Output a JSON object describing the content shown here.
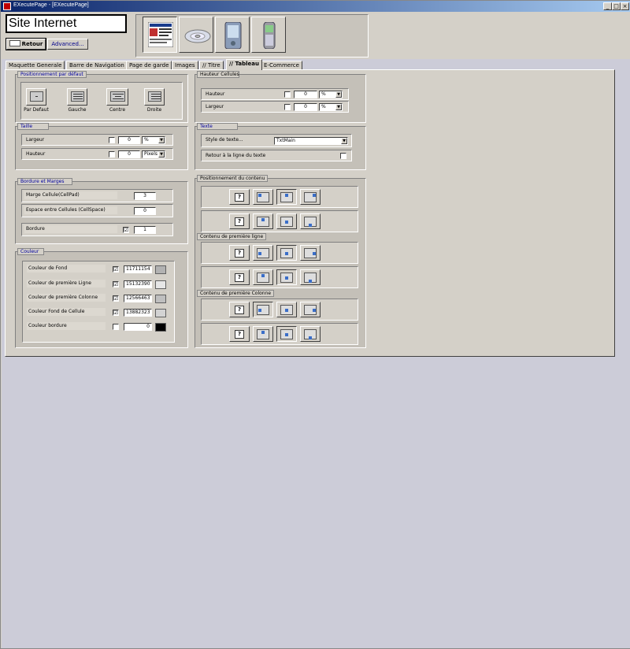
{
  "window": {
    "title": "EXecutePage - [EXecutePage]",
    "buttons": [
      "_",
      "□",
      "×"
    ]
  },
  "header": {
    "site_title": "Site Internet",
    "back_label": "Retour",
    "advanced_label": "Advanced..."
  },
  "tabs": [
    {
      "label": "Maquette Generale"
    },
    {
      "label": "Barre de Navigation"
    },
    {
      "label": "Page de garde"
    },
    {
      "label": "Images"
    },
    {
      "label": "// Titre"
    },
    {
      "label": "// Tableau"
    },
    {
      "label": "E-Commerce"
    }
  ],
  "positionnement_defaut": {
    "label": "Positionnement par défaut",
    "options": [
      "Par Defaut",
      "Gauche",
      "Centre",
      "Droite"
    ]
  },
  "taille": {
    "label": "Taille",
    "largeur": {
      "label": "Largeur",
      "value": "0",
      "unit": "%"
    },
    "hauteur": {
      "label": "Hauteur",
      "value": "0",
      "unit": "Pixels"
    }
  },
  "hauteur_cellules": {
    "label": "Hauteur Cellules",
    "hauteur": {
      "label": "Hauteur",
      "value": "0",
      "unit": "%"
    },
    "largeur": {
      "label": "Largeur",
      "value": "0",
      "unit": "%"
    }
  },
  "texte": {
    "label": "Texte",
    "style": {
      "label": "Style de texte...",
      "value": "TxtMain"
    },
    "retour": {
      "label": "Retour à la ligne du texte"
    }
  },
  "bordure": {
    "label": "Bordure et Marges",
    "marge": {
      "label": "Marge Cellule(CellPad)",
      "value": "3"
    },
    "espace": {
      "label": "Espace entre Cellules (CellSpace)",
      "value": "0"
    },
    "bordure": {
      "label": "Bordure",
      "value": "1",
      "check": "☑"
    }
  },
  "couleur": {
    "label": "Couleur",
    "rows": [
      {
        "label": "Couleur de Fond",
        "check": "☑",
        "value": "11711154",
        "color": "#b2b2b2"
      },
      {
        "label": "Couleur de première Ligne",
        "check": "☑",
        "value": "15132390",
        "color": "#e6e6e6"
      },
      {
        "label": "Couleur de première Colonne",
        "check": "☑",
        "value": "12566463",
        "color": "#bfbfbf"
      },
      {
        "label": "Couleur Fond de Cellule",
        "check": "☑",
        "value": "13882323",
        "color": "#d3d3d3"
      },
      {
        "label": "Couleur bordure",
        "check": "",
        "value": "0",
        "color": "#000000"
      }
    ]
  },
  "pos_contenu": {
    "label": "Positionnement du contenu"
  },
  "premiere_ligne": {
    "label": "Contenu de première ligne"
  },
  "premiere_colonne": {
    "label": "Contenu de première Colonne"
  },
  "icons": {
    "question": "?"
  }
}
